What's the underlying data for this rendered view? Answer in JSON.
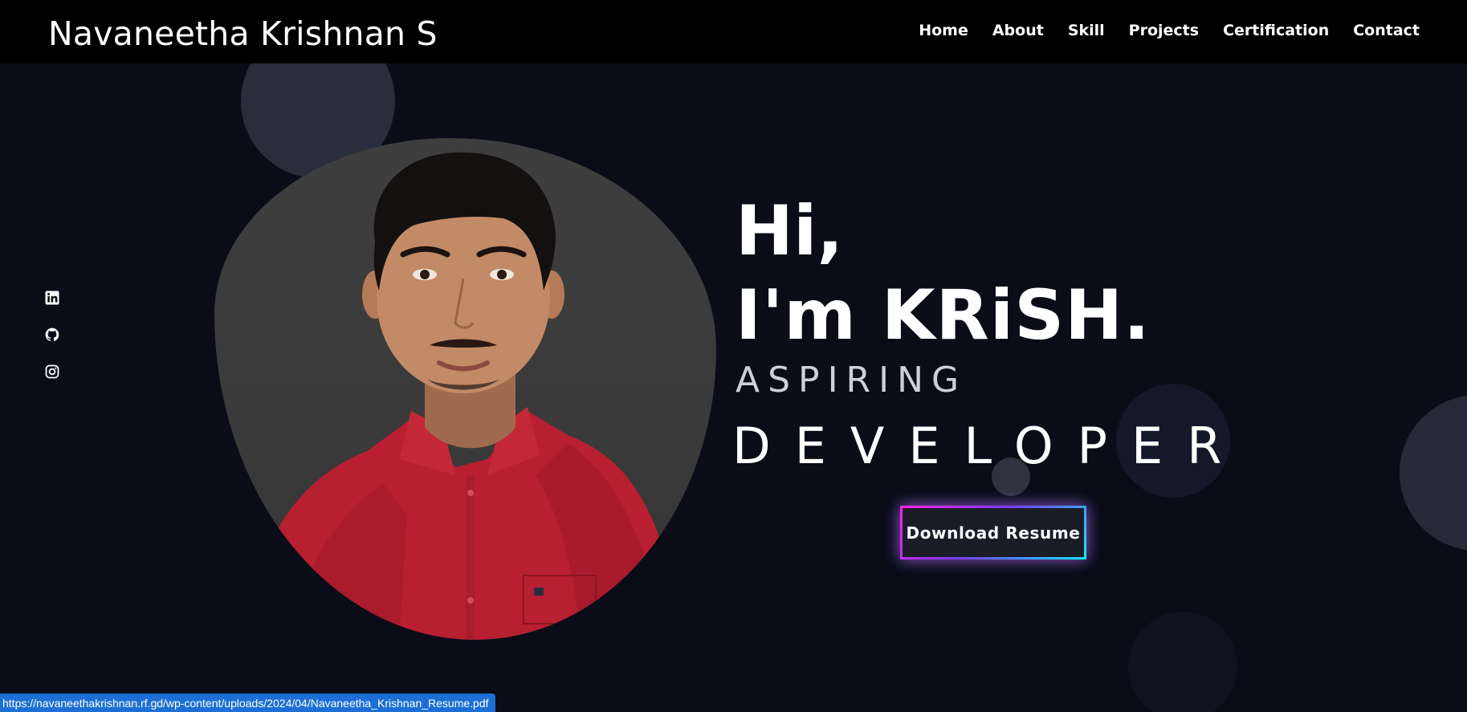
{
  "header": {
    "brand": "Navaneetha Krishnan S",
    "nav": [
      "Home",
      "About",
      "Skill",
      "Projects",
      "Certification",
      "Contact"
    ]
  },
  "social": {
    "icons": [
      "linkedin-icon",
      "github-icon",
      "instagram-icon"
    ]
  },
  "hero": {
    "greeting": "Hi,",
    "name": "I'm KRiSH.",
    "subtitle_1": "ASPIRING",
    "subtitle_2": "DEVELOPER",
    "button_label": "Download Resume"
  },
  "status_bar": {
    "url": "https://navaneethakrishnan.rf.gd/wp-content/uploads/2024/04/Navaneetha_Krishnan_Resume.pdf"
  },
  "colors": {
    "background": "#0a0c18",
    "header": "#000000",
    "button_gradient_start": "#ff20e8",
    "button_gradient_end": "#13e4ff",
    "status_bar": "#1c6fd4",
    "shirt": "#b81f31"
  }
}
